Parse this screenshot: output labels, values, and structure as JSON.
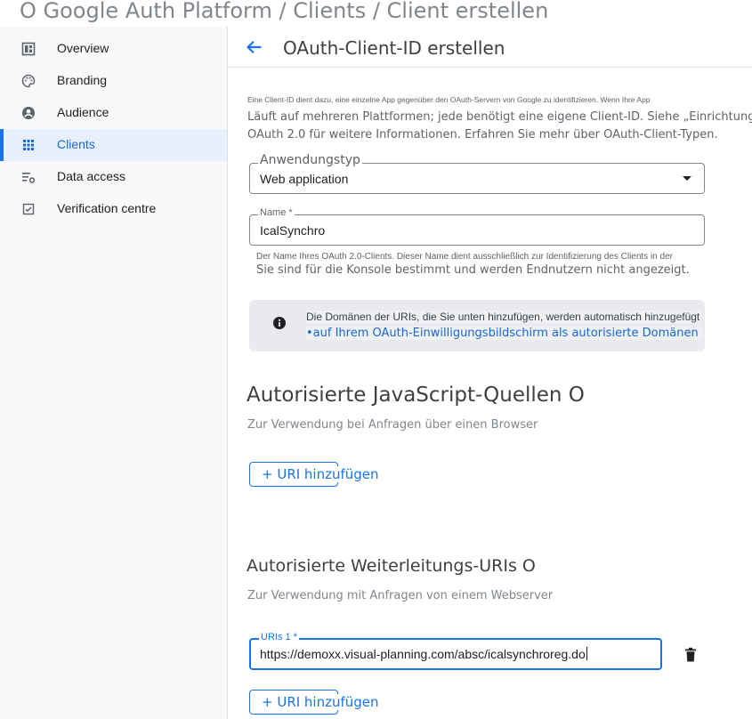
{
  "breadcrumb": "O Google Auth Platform / Clients / Client erstellen",
  "sidebar": {
    "items": [
      {
        "label": "Overview",
        "icon": "dashboard-icon"
      },
      {
        "label": "Branding",
        "icon": "palette-icon"
      },
      {
        "label": "Audience",
        "icon": "account-circle-icon"
      },
      {
        "label": "Clients",
        "icon": "grid-icon",
        "active": true
      },
      {
        "label": "Data access",
        "icon": "data-settings-icon"
      },
      {
        "label": "Verification centre",
        "icon": "checkbox-icon"
      }
    ]
  },
  "header": {
    "back_icon": "arrow-back-icon",
    "title": "OAuth-Client-ID erstellen"
  },
  "intro": {
    "line1": "Eine Client-ID dient dazu, eine einzelne App gegenüber den OAuth-Servern von Google zu identifizieren. Wenn Ihre App",
    "line2": "Läuft auf mehreren Plattformen; jede benötigt eine eigene Client-ID. Siehe „Einrichtung“",
    "line3": "OAuth 2.0 für weitere Informationen. Erfahren Sie mehr über OAuth-Client-Typen."
  },
  "app_type": {
    "label": "Anwendungstyp",
    "value": "Web application"
  },
  "name_field": {
    "label": "Name *",
    "value": "IcalSynchro",
    "hint1": "Der Name Ihres OAuth 2.0-Clients. Dieser Name dient ausschließlich zur Identifizierung des Clients in der",
    "hint2": "Sie sind für die Konsole bestimmt und werden Endnutzern nicht angezeigt."
  },
  "info": {
    "icon": "info-icon",
    "line1": "Die Domänen der URIs, die Sie unten hinzufügen, werden automatisch hinzugefügt",
    "line2": "•auf Ihrem OAuth-Einwilligungsbildschirm als autorisierte Domänen"
  },
  "js_origins": {
    "title": "Autorisierte JavaScript-Quellen O",
    "subtitle": "Zur Verwendung bei Anfragen über einen Browser",
    "add_label": "+ URI hinzufügen"
  },
  "redirects": {
    "title": "Autorisierte Weiterleitungs-URIs O",
    "subtitle": "Zur Verwendung mit Anfragen von einem Webserver",
    "uri_label": "URIs 1 *",
    "uri_value": "https://demoxx.visual-planning.com/absc/icalsynchroreg.do",
    "add_label": "+ URI hinzufügen",
    "delete_icon": "trash-icon"
  },
  "colors": {
    "accent": "#1a73e8",
    "active_bg": "#e8f0fe",
    "sidebar_bg": "#f8f9fa",
    "info_bg": "#e8eaed"
  }
}
